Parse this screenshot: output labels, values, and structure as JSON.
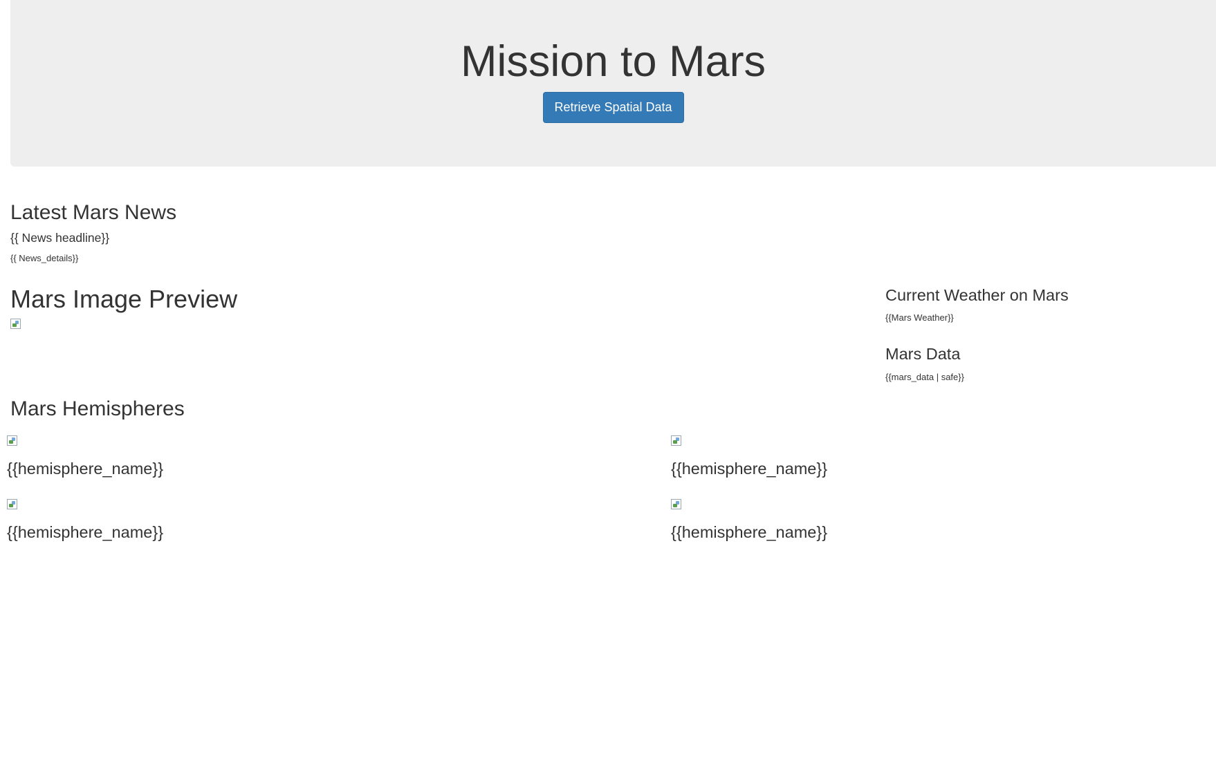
{
  "header": {
    "title": "Mission to Mars",
    "button_label": "Retrieve Spatial Data"
  },
  "news": {
    "heading": "Latest Mars News",
    "headline": "{{ News headline}}",
    "details": "{{ News_details}}"
  },
  "image_preview": {
    "heading": "Mars Image Preview"
  },
  "weather": {
    "heading": "Current Weather on Mars",
    "text": "{{Mars Weather}}"
  },
  "mars_data": {
    "heading": "Mars Data",
    "text": "{{mars_data | safe}}"
  },
  "hemispheres": {
    "heading": "Mars Hemispheres",
    "items": [
      {
        "name": "{{hemisphere_name}}"
      },
      {
        "name": "{{hemisphere_name}}"
      },
      {
        "name": "{{hemisphere_name}}"
      },
      {
        "name": "{{hemisphere_name}}"
      }
    ]
  },
  "colors": {
    "jumbotron_bg": "#eeeeee",
    "button_primary": "#337ab7",
    "text": "#333333"
  }
}
